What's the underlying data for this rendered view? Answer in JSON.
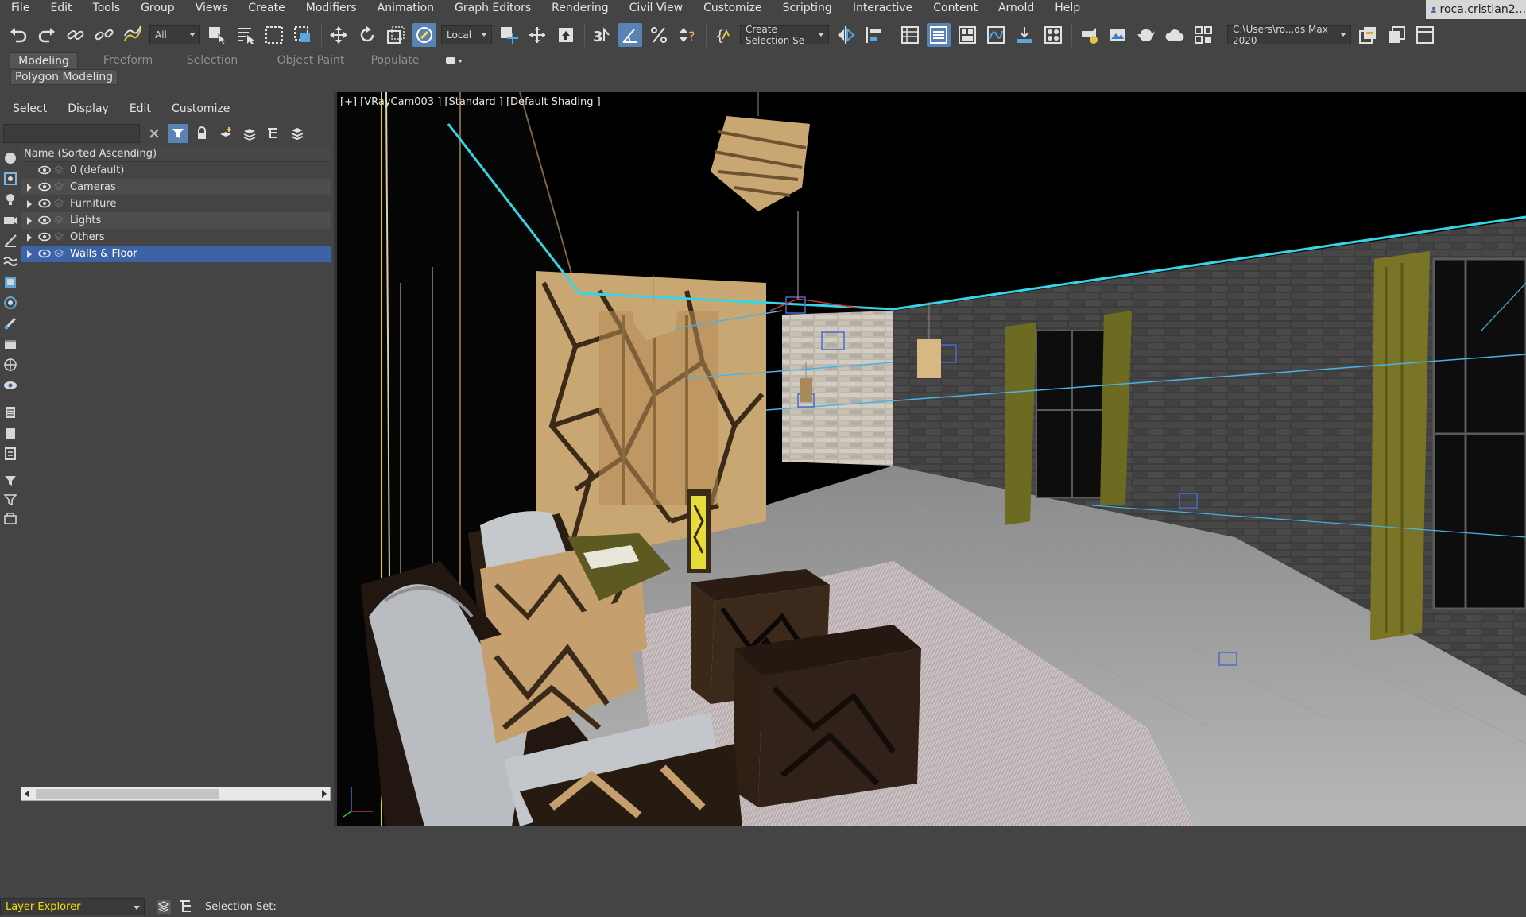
{
  "menu": [
    "File",
    "Edit",
    "Tools",
    "Group",
    "Views",
    "Create",
    "Modifiers",
    "Animation",
    "Graph Editors",
    "Rendering",
    "Civil View",
    "Customize",
    "Scripting",
    "Interactive",
    "Content",
    "Arnold",
    "Help"
  ],
  "user": "roca.cristian2...",
  "toolbar": {
    "filter_value": "All",
    "coord_value": "Local",
    "selection_set_value": "Create Selection Se",
    "project_path": "C:\\Users\\ro...ds Max 2020"
  },
  "ribbon": {
    "tabs": [
      "Modeling",
      "Freeform",
      "Selection",
      "Object Paint",
      "Populate"
    ],
    "active_tab": "Modeling",
    "sub_label": "Polygon Modeling"
  },
  "scene_explorer": {
    "menu": [
      "Select",
      "Display",
      "Edit",
      "Customize"
    ],
    "column_header": "Name (Sorted Ascending)",
    "layers": [
      {
        "name": "0 (default)",
        "expandable": false,
        "selected": false
      },
      {
        "name": "Cameras",
        "expandable": true,
        "selected": false
      },
      {
        "name": "Furniture",
        "expandable": true,
        "selected": false
      },
      {
        "name": "Lights",
        "expandable": true,
        "selected": false
      },
      {
        "name": "Others",
        "expandable": true,
        "selected": false
      },
      {
        "name": "Walls & Floor",
        "expandable": true,
        "selected": true
      }
    ]
  },
  "status": {
    "explorer_name": "Layer Explorer",
    "selection_set_label": "Selection Set:"
  },
  "viewport": {
    "label": "[+] [VRayCam003 ] [Standard ] [Default Shading ]"
  },
  "colors": {
    "ui_background": "#444444",
    "accent_blue": "#5a83b5",
    "selected_row": "#3c63a6",
    "layer_explorer_text": "#f2e100",
    "camera_line": "#37d4e6"
  }
}
